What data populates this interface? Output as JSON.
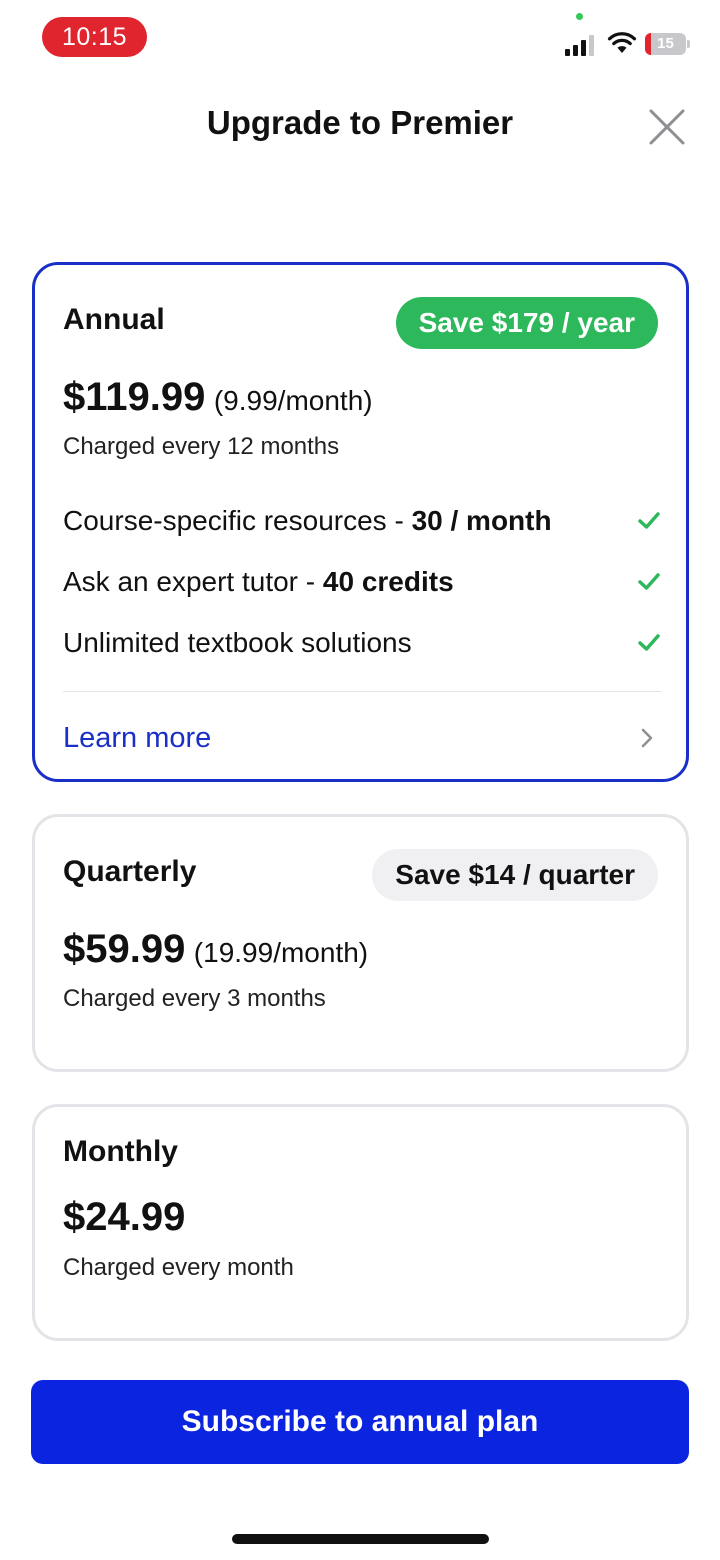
{
  "status_bar": {
    "time": "10:15",
    "battery_level": "15",
    "battery_fraction": 0.15,
    "signal_icon": "cellular-signal-icon",
    "wifi_icon": "wifi-icon",
    "battery_icon": "battery-low-icon"
  },
  "header": {
    "title": "Upgrade to Premier",
    "close_icon": "close-icon"
  },
  "plans": {
    "annual": {
      "name": "Annual",
      "badge": "Save $179 / year",
      "price": "$119.99",
      "per_month": "(9.99/month)",
      "charged": "Charged every 12 months",
      "selected": true,
      "features": [
        {
          "text": "Course-specific resources - ",
          "bold": "30 / month",
          "icon": "checkmark-icon"
        },
        {
          "text": "Ask an expert tutor - ",
          "bold": "40 credits",
          "icon": "checkmark-icon"
        },
        {
          "text": "Unlimited textbook solutions",
          "bold": "",
          "icon": "checkmark-icon"
        }
      ],
      "learn_more": "Learn more",
      "learn_more_icon": "chevron-right-icon"
    },
    "quarterly": {
      "name": "Quarterly",
      "badge": "Save $14 / quarter",
      "price": "$59.99",
      "per_month": "(19.99/month)",
      "charged": "Charged every 3 months",
      "selected": false
    },
    "monthly": {
      "name": "Monthly",
      "price": "$24.99",
      "charged": "Charged every month",
      "selected": false
    }
  },
  "cta": {
    "label": "Subscribe to annual plan"
  },
  "colors": {
    "accent_blue": "#0b24e0",
    "selected_border": "#1a2fc7",
    "save_green": "#2eb85c",
    "check_green": "#2eb85c",
    "time_pill_red": "#e0252f"
  }
}
